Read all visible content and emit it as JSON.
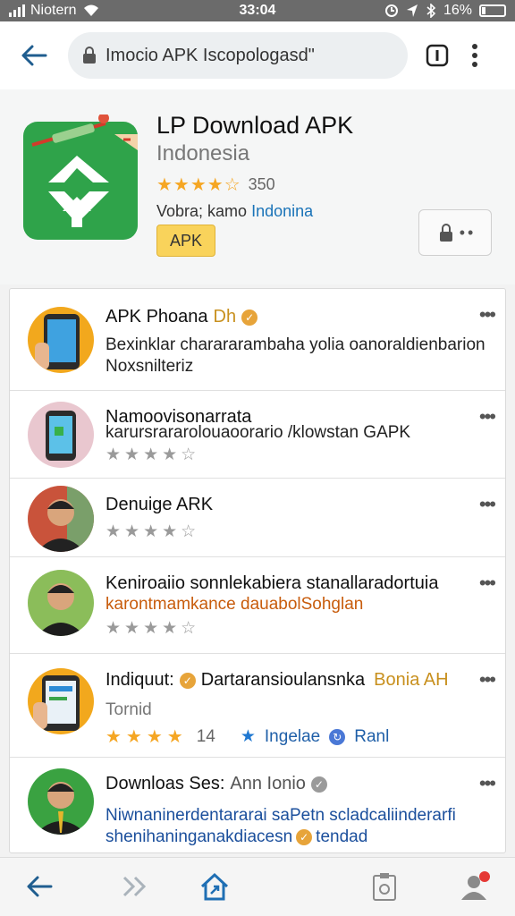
{
  "status_bar": {
    "carrier": "Niotern",
    "time": "33:04",
    "battery": "16%"
  },
  "browser": {
    "url": "Imocio APK Iscopologasd\""
  },
  "app_header": {
    "title": "LP Download APK",
    "subtitle": "Indonesia",
    "rating_stars": "★★★★☆",
    "rating_count": "350",
    "meta_prefix": "Vobra; kamo",
    "meta_link": "Indonina",
    "badge": "APK",
    "colors": {
      "brand_green": "#2fa34a",
      "star": "#f5a623",
      "badge": "#f9d35b"
    }
  },
  "list": [
    {
      "title": "APK Phoana",
      "title_suffix": "Dh",
      "line1": "Bexinklar charararambaha yolia oanoraldienbarion",
      "line2": "Noxsnilteriz"
    },
    {
      "title": "Namoovisonarrata",
      "line1": "karursrararolouaoorario /klowstan GAPK",
      "stars": "★★★★☆"
    },
    {
      "title": "Denuige ARK",
      "stars": "★★★★☆"
    },
    {
      "title": "Keniroaiio sonnlekabiera stanallaradortuia",
      "line1": "karontmamkance dauabolSohglan",
      "stars": "★★★★☆"
    },
    {
      "title": "Indiquut:",
      "title_mid": "Dartaransioulansnka",
      "title_end": "Bonia AH",
      "line1": "Tornid",
      "stars": "★★★★",
      "count": "14",
      "tag1": "Ingelae",
      "tag2": "Ranl"
    },
    {
      "title": "Downloas Ses:",
      "title_end": "Ann Ionio",
      "line1": "Niwnaninerdentararai saPetn scladcaliinderarfi",
      "line2": "shenihaninganakdiacesn",
      "line2_end": "tendad"
    }
  ]
}
